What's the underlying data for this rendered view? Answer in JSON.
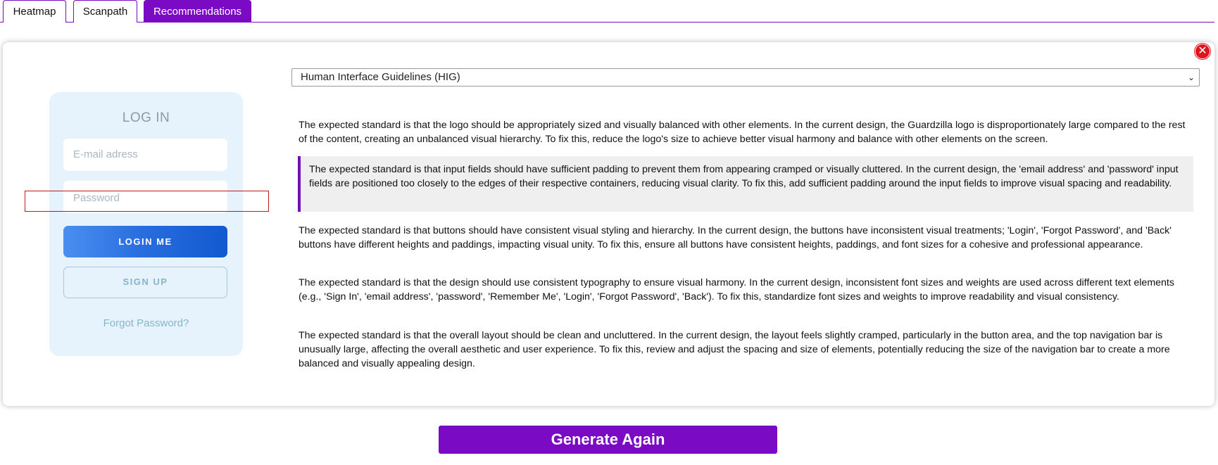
{
  "tabs": [
    {
      "label": "Heatmap"
    },
    {
      "label": "Scanpath"
    },
    {
      "label": "Recommendations"
    }
  ],
  "active_tab": "Recommendations",
  "close_icon": "close-icon",
  "preview": {
    "title": "LOG IN",
    "email_placeholder": "E-mail adress",
    "password_placeholder": "Password",
    "login_button": "LOGIN ME",
    "signup_button": "SIGN UP",
    "forgot_link": "Forgot Password?"
  },
  "guideline_select": {
    "selected": "Human Interface Guidelines (HIG)"
  },
  "recommendations": [
    "The expected standard is that the logo should be appropriately sized and visually balanced with other elements. In the current design, the Guardzilla logo is disproportionately large compared to the rest of the content, creating an unbalanced visual hierarchy. To fix this, reduce the logo's size to achieve better visual harmony and balance with other elements on the screen.",
    "The expected standard is that input fields should have sufficient padding to prevent them from appearing cramped or visually cluttered. In the current design, the 'email address' and 'password' input fields are positioned too closely to the edges of their respective containers, reducing visual clarity. To fix this, add sufficient padding around the input fields to improve visual spacing and readability.",
    "The expected standard is that buttons should have consistent visual styling and hierarchy. In the current design, the buttons have inconsistent visual treatments; 'Login', 'Forgot Password', and 'Back' buttons have different heights and paddings, impacting visual unity. To fix this, ensure all buttons have consistent heights, paddings, and font sizes for a cohesive and professional appearance.",
    "The expected standard is that the design should use consistent typography to ensure visual harmony. In the current design, inconsistent font sizes and weights are used across different text elements (e.g., 'Sign In', 'email address', 'password', 'Remember Me', 'Login', 'Forgot Password', 'Back'). To fix this, standardize font sizes and weights to improve readability and visual consistency.",
    "The expected standard is that the overall layout should be clean and uncluttered. In the current design, the layout feels slightly cramped, particularly in the button area, and the top navigation bar is unusually large, affecting the overall aesthetic and user experience. To fix this, review and adjust the spacing and size of elements, potentially reducing the size of the navigation bar to create a more balanced and visually appealing design."
  ],
  "highlighted_recommendation": 2,
  "generate_button": "Generate Again",
  "colors": {
    "accent": "#7a0ac4",
    "close": "#e0141e",
    "highlight_box": "#c01a1a"
  }
}
